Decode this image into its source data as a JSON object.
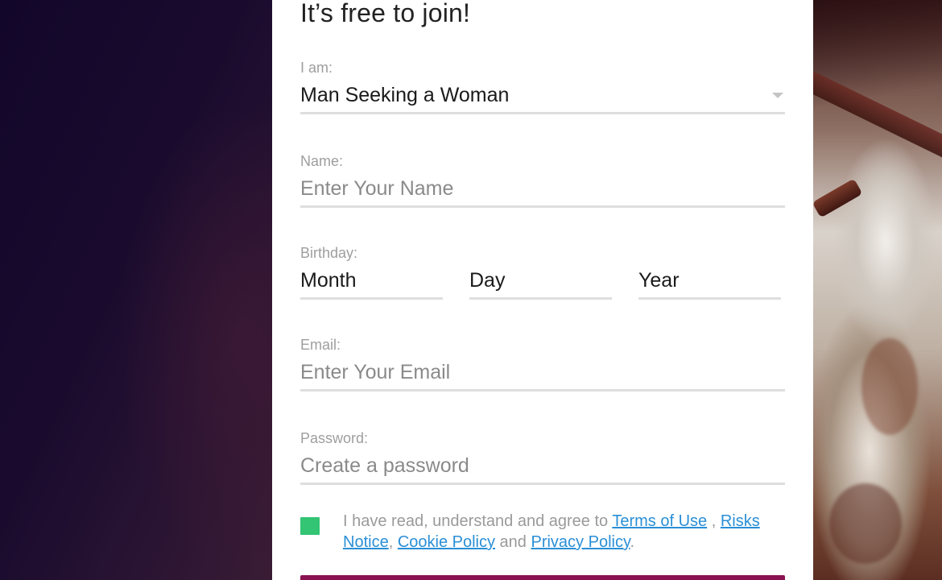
{
  "form": {
    "title": "It’s free to join!",
    "seeking": {
      "label": "I am:",
      "value": "Man Seeking a Woman"
    },
    "name": {
      "label": "Name:",
      "placeholder": "Enter Your Name"
    },
    "birthday": {
      "label": "Birthday:",
      "month": "Month",
      "day": "Day",
      "year": "Year"
    },
    "email": {
      "label": "Email:",
      "placeholder": "Enter Your Email"
    },
    "password": {
      "label": "Password:",
      "placeholder": "Create a password"
    },
    "consent": {
      "checked": true,
      "text_before": "I have read, understand and agree to ",
      "terms_link": "Terms of Use",
      "sep1": " , ",
      "risks_link": "Risks Notice",
      "sep2": ", ",
      "cookie_link": "Cookie Policy",
      "sep3": " and ",
      "privacy_link": "Privacy Policy",
      "end": "."
    }
  },
  "colors": {
    "checkbox": "#33c474",
    "link": "#2a8fd6",
    "submit": "#8a1252",
    "background": "#170a2b"
  }
}
